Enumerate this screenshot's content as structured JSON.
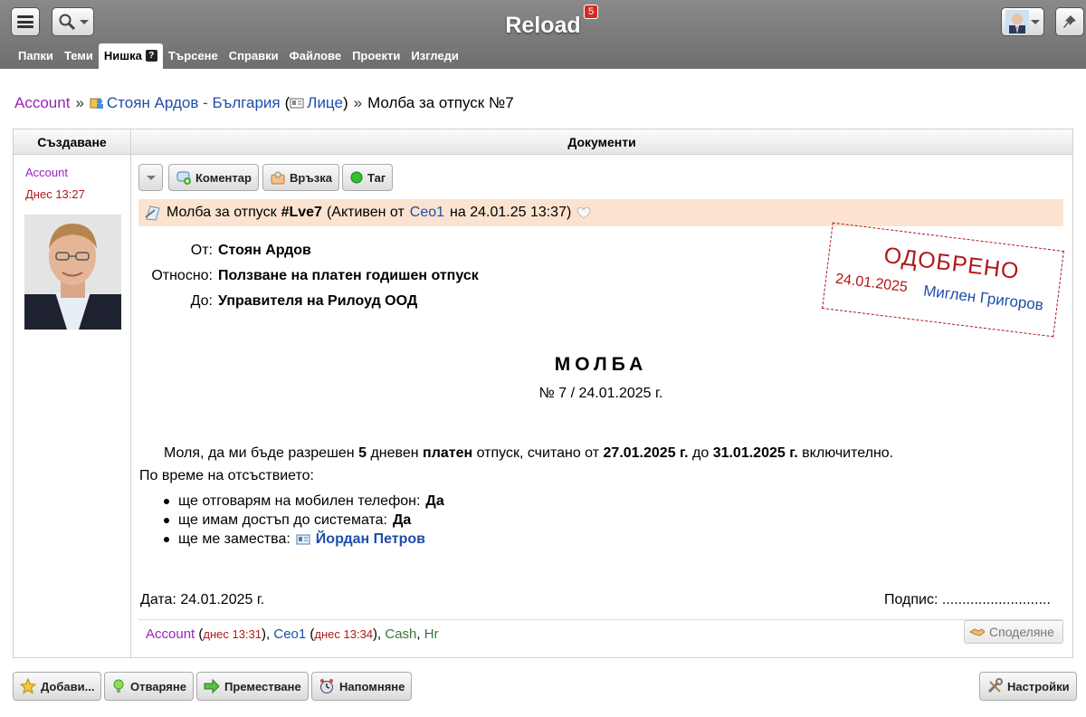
{
  "app": {
    "title": "Reload",
    "badge": "5"
  },
  "tabs": [
    {
      "label": "Папки"
    },
    {
      "label": "Теми"
    },
    {
      "label": "Нишка",
      "help": "?"
    },
    {
      "label": "Търсене"
    },
    {
      "label": "Справки"
    },
    {
      "label": "Файлове"
    },
    {
      "label": "Проекти"
    },
    {
      "label": "Изгледи"
    }
  ],
  "breadcrumb": {
    "root": "Account",
    "sep": "»",
    "contact": "Стоян Ардов - България",
    "paren_open": "(",
    "category": "Лице",
    "paren_close": ")",
    "current": "Молба за отпуск №7"
  },
  "columns": {
    "left": "Създаване",
    "right": "Документи"
  },
  "creator": {
    "name": "Account",
    "time": "Днес 13:27"
  },
  "actions": {
    "comment": "Коментар",
    "link": "Връзка",
    "tag": "Таг"
  },
  "message": {
    "title": "Молба за отпуск",
    "id": "#Lve7",
    "status_prefix": "(Активен от",
    "user": "Ceo1",
    "date_text": "на 24.01.25 13:37)"
  },
  "fields": [
    {
      "label": "От:",
      "value": "Стоян Ардов"
    },
    {
      "label": "Относно:",
      "value": "Ползване на платен годишен отпуск"
    },
    {
      "label": "До:",
      "value": "Управителя на Рилоуд ООД"
    }
  ],
  "stamp": {
    "text": "ОДОБРЕНО",
    "date": "24.01.2025",
    "name": "Миглен Григоров"
  },
  "document": {
    "title": "МОЛБА",
    "number": "№ 7 / 24.01.2025 г.",
    "p1": "Моля, да ми бъде разрешен",
    "days": "5",
    "p2": "дневен",
    "paid": "платен",
    "p3": "отпуск, считано от",
    "from": "27.01.2025 г.",
    "p4": "до",
    "to": "31.01.2025 г.",
    "p5": "включително.",
    "absence_intro": "По време на отсъствието:",
    "items": [
      {
        "text": "ще отговарям на мобилен телефон:",
        "value": "Да"
      },
      {
        "text": "ще имам достъп до системата:",
        "value": "Да"
      },
      {
        "text": "ще ме замества:",
        "value": "Йордан Петров"
      }
    ],
    "date_line": "Дата: 24.01.2025 г.",
    "signature_line": "Подпис: ..........................."
  },
  "participants": {
    "u1": "Account",
    "t1": "днес 13:31",
    "u2": "Ceo1",
    "t2": "днес 13:34",
    "tag1": "Cash",
    "tag2": "Hr"
  },
  "share": "Споделяне",
  "bottom": {
    "add": "Добави...",
    "open": "Отваряне",
    "move": "Преместване",
    "remind": "Напомняне",
    "settings": "Настройки"
  },
  "colors": {
    "topbar": "#7a7a7a",
    "account": "#9a23b8",
    "link": "#1e4ea8",
    "stamp": "#b01818",
    "header_bg": "#fbe3cf"
  }
}
